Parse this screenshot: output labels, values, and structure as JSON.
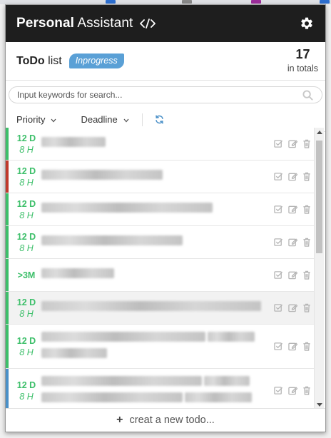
{
  "app": {
    "title_bold": "Personal",
    "title_rest": "Assistant",
    "accent": "#5aa0d6",
    "green": "#3dbf6a",
    "red": "#c0392b",
    "blue": "#4a90c8"
  },
  "summary": {
    "title_bold": "ToDo",
    "title_rest": "list",
    "badge": "Inprogress",
    "count": "17",
    "count_label": "in totals"
  },
  "search": {
    "placeholder": "Input keywords for search..."
  },
  "filters": {
    "priority": "Priority",
    "deadline": "Deadline"
  },
  "todos": [
    {
      "days": "12 D",
      "hours": "8 H",
      "color": "#3dbf6a",
      "lines": [
        90
      ]
    },
    {
      "days": "12 D",
      "hours": "8 H",
      "color": "#c0392b",
      "lines": [
        170
      ]
    },
    {
      "days": "12 D",
      "hours": "8 H",
      "color": "#3dbf6a",
      "lines": [
        240
      ]
    },
    {
      "days": "12 D",
      "hours": "8 H",
      "color": "#3dbf6a",
      "lines": [
        198
      ]
    },
    {
      "days": ">3M",
      "hours": "",
      "color": "#3dbf6a",
      "lines": [
        102
      ]
    },
    {
      "days": "12 D",
      "hours": "8 H",
      "color": "#3dbf6a",
      "lines": [
        308
      ]
    },
    {
      "days": "12 D",
      "hours": "8 H",
      "color": "#3dbf6a",
      "lines": [
        230,
        66,
        92
      ]
    },
    {
      "days": "12 D",
      "hours": "8 H",
      "color": "#4a90c8",
      "lines": [
        225,
        64,
        198,
        94
      ]
    }
  ],
  "footer": {
    "label": "creat a new todo..."
  }
}
